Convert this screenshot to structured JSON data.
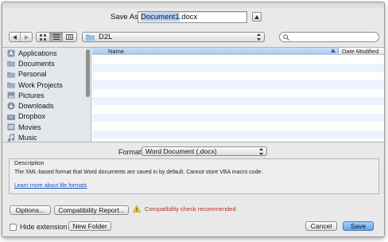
{
  "dialog": {
    "save_as_label": "Save As:",
    "filename_selected": "Document1",
    "filename_ext": ".docx"
  },
  "toolbar": {
    "current_folder": "D2L",
    "search_placeholder": ""
  },
  "sidebar": {
    "items": [
      {
        "label": "Applications",
        "icon": "applications-icon"
      },
      {
        "label": "Documents",
        "icon": "folder-icon"
      },
      {
        "label": "Personal",
        "icon": "folder-icon"
      },
      {
        "label": "Work Projects",
        "icon": "folder-icon"
      },
      {
        "label": "Pictures",
        "icon": "pictures-icon"
      },
      {
        "label": "Downloads",
        "icon": "downloads-icon"
      },
      {
        "label": "Dropbox",
        "icon": "dropbox-icon"
      },
      {
        "label": "Movies",
        "icon": "movies-icon"
      },
      {
        "label": "Music",
        "icon": "music-icon"
      }
    ]
  },
  "file_list": {
    "columns": [
      "Name",
      "Date Modified"
    ]
  },
  "options": {
    "format_label": "Format:",
    "format_value": "Word Document (.docx)",
    "description_title": "Description",
    "description_text": "The XML-based format that Word documents are saved in by default. Cannot store VBA macro code.",
    "learn_more_link": "Learn more about file formats",
    "options_button": "Options...",
    "compat_button": "Compatibility Report...",
    "compat_warning": "Compatibility check recommended"
  },
  "bottom": {
    "hide_extension": "Hide extension",
    "new_folder": "New Folder",
    "cancel": "Cancel",
    "save": "Save"
  },
  "colors": {
    "accent": "#5ea5ea",
    "warning_text": "#b8312a",
    "link": "#1a56c4"
  }
}
